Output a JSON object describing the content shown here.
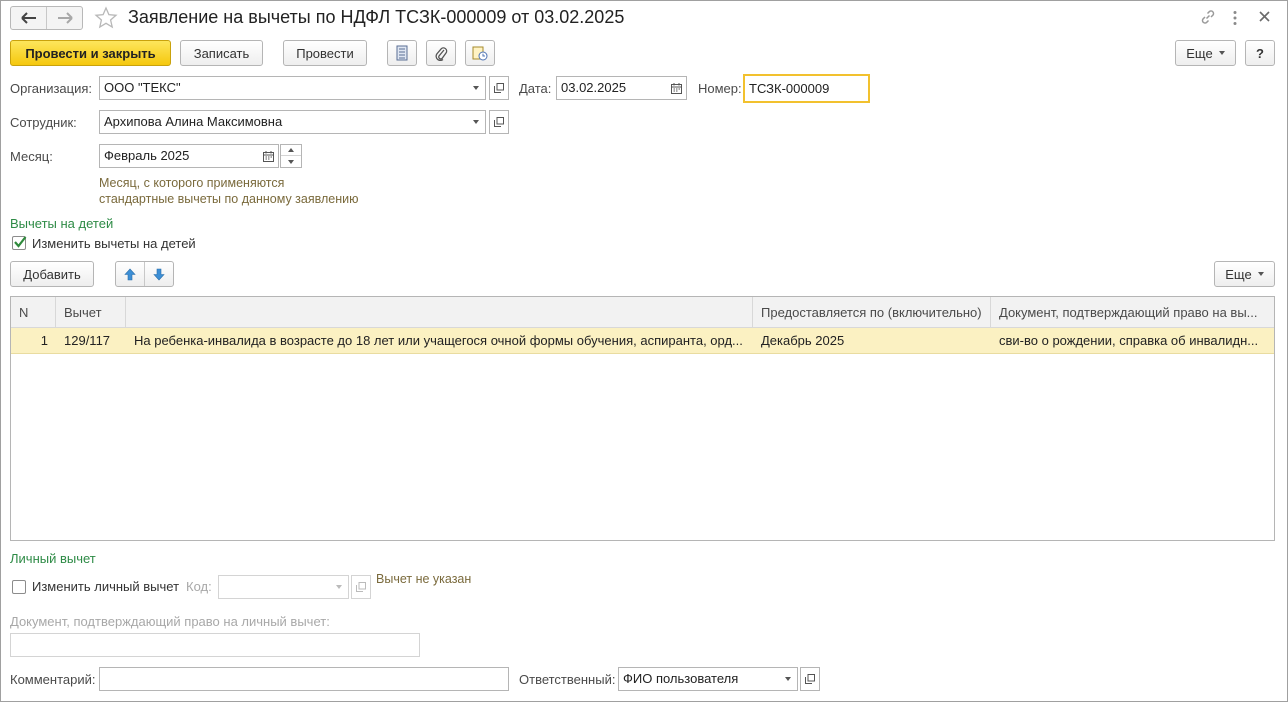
{
  "window": {
    "title": "Заявление на вычеты по НДФЛ ТСЗК-000009 от 03.02.2025"
  },
  "toolbar": {
    "post_close": "Провести и закрыть",
    "save": "Записать",
    "post": "Провести",
    "more": "Еще",
    "help": "?"
  },
  "form": {
    "org_label": "Организация:",
    "org_value": "ООО \"ТЕКС\"",
    "date_label": "Дата:",
    "date_value": "03.02.2025",
    "number_label": "Номер:",
    "number_value": "ТСЗК-000009",
    "employee_label": "Сотрудник:",
    "employee_value": "Архипова Алина Максимовна",
    "month_label": "Месяц:",
    "month_value": "Февраль 2025",
    "month_hint_1": "Месяц, с которого применяются",
    "month_hint_2": "стандартные вычеты по данному заявлению"
  },
  "children": {
    "section_title": "Вычеты на детей",
    "change_checkbox_label": "Изменить вычеты на детей",
    "change_checked": true,
    "add_button": "Добавить",
    "more_button": "Еще",
    "columns": [
      "N",
      "Вычет",
      "",
      "Предоставляется по (включительно)",
      "Документ, подтверждающий право на вы..."
    ],
    "rows": [
      {
        "n": "1",
        "code": "129/117",
        "description": "На ребенка-инвалида в возрасте до 18 лет или учащегося очной формы обучения, аспиранта, орд...",
        "until": "Декабрь 2025",
        "document": "сви-во о рождении, справка об инвалидн..."
      }
    ]
  },
  "personal": {
    "section_title": "Личный вычет",
    "change_checkbox_label": "Изменить личный вычет",
    "change_checked": false,
    "code_label": "Код:",
    "code_value": "",
    "not_set": "Вычет не указан",
    "doc_label": "Документ, подтверждающий право на личный вычет:",
    "doc_value": ""
  },
  "footer": {
    "comment_label": "Комментарий:",
    "comment_value": "",
    "responsible_label": "Ответственный:",
    "responsible_value": "ФИО пользователя"
  },
  "colors": {
    "primary_button": "#f5c80e",
    "section_green": "#2e8b46",
    "selected_row": "#fbf1c2",
    "hint_text": "#7a6a3c",
    "focus_border": "#f2c12e"
  }
}
